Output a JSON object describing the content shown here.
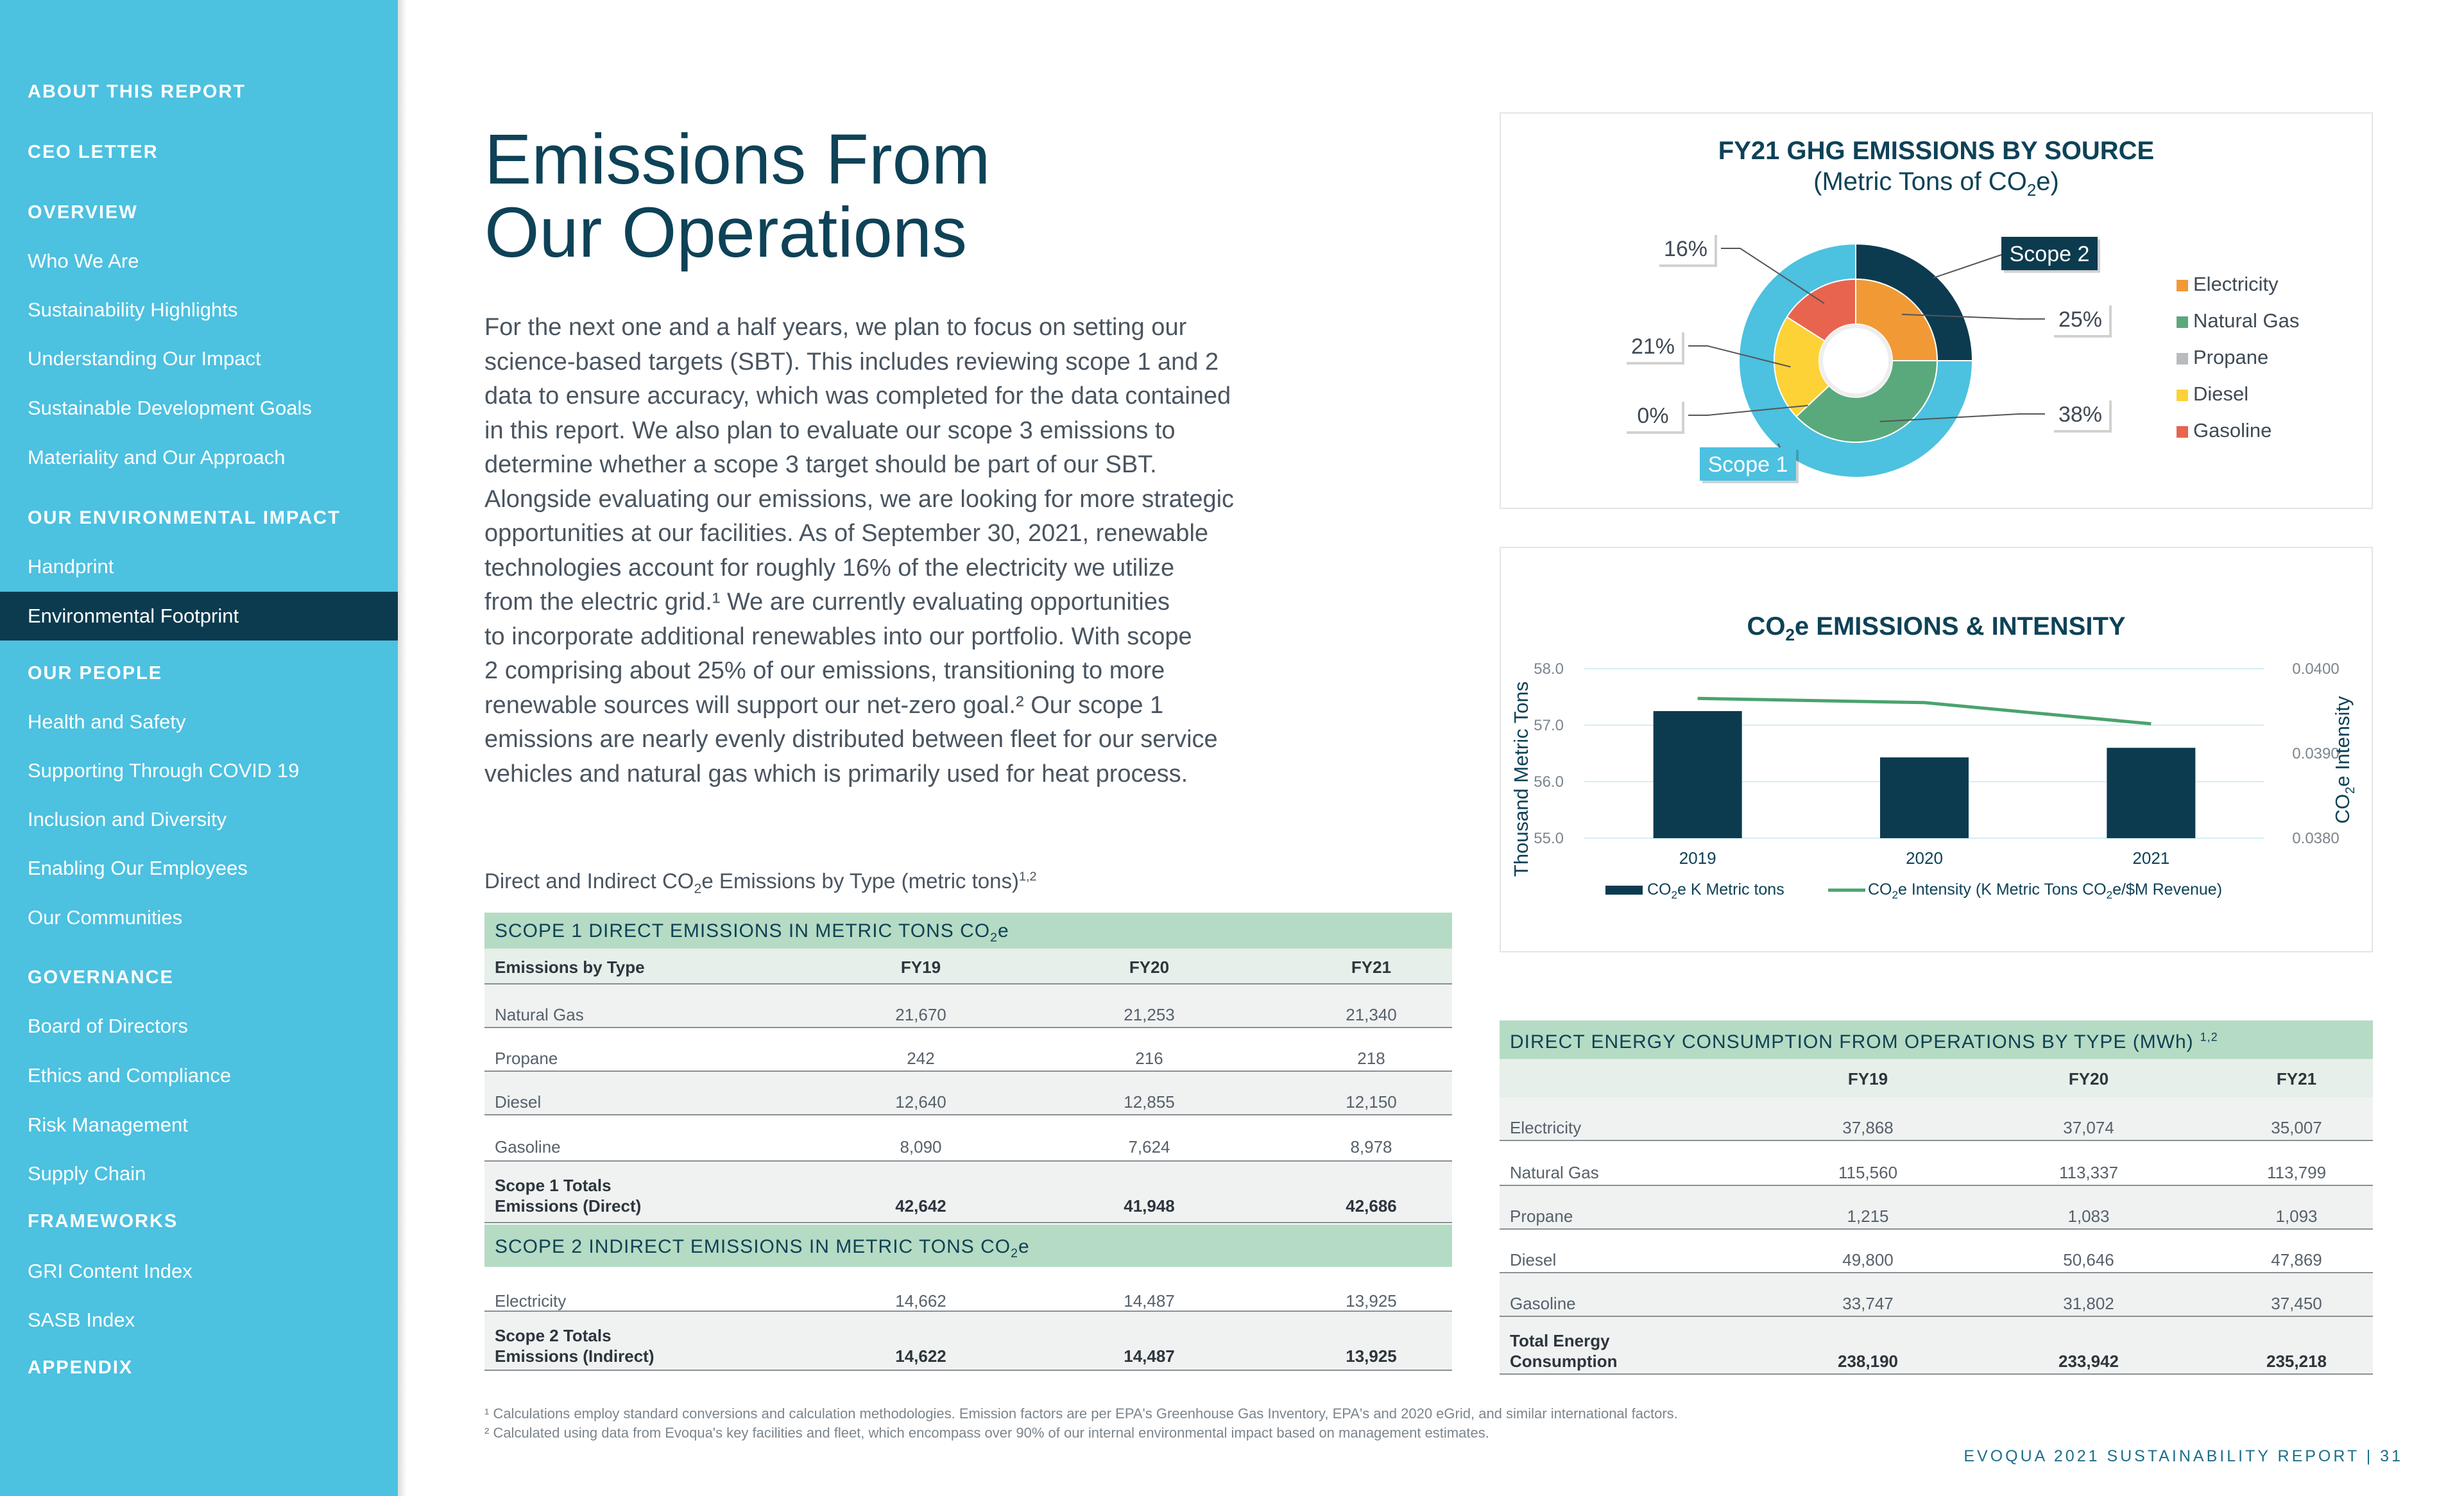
{
  "sidebar": {
    "items": [
      {
        "label": "ABOUT THIS REPORT",
        "type": "head"
      },
      {
        "label": "CEO LETTER",
        "type": "head"
      },
      {
        "label": "OVERVIEW",
        "type": "head"
      },
      {
        "label": "Who We Are",
        "type": "item"
      },
      {
        "label": "Sustainability Highlights",
        "type": "item"
      },
      {
        "label": "Understanding Our Impact",
        "type": "item"
      },
      {
        "label": "Sustainable Development Goals",
        "type": "item"
      },
      {
        "label": "Materiality and Our Approach",
        "type": "item"
      },
      {
        "label": "OUR ENVIRONMENTAL IMPACT",
        "type": "head"
      },
      {
        "label": "Handprint",
        "type": "item"
      },
      {
        "label": "Environmental Footprint",
        "type": "active"
      },
      {
        "label": "OUR PEOPLE",
        "type": "head"
      },
      {
        "label": "Health and Safety",
        "type": "item"
      },
      {
        "label": "Supporting Through COVID 19",
        "type": "item"
      },
      {
        "label": "Inclusion and Diversity",
        "type": "item"
      },
      {
        "label": "Enabling Our Employees",
        "type": "item"
      },
      {
        "label": "Our Communities",
        "type": "item"
      },
      {
        "label": "GOVERNANCE",
        "type": "head"
      },
      {
        "label": "Board of Directors",
        "type": "item"
      },
      {
        "label": "Ethics and Compliance",
        "type": "item"
      },
      {
        "label": "Risk Management",
        "type": "item"
      },
      {
        "label": "Supply Chain",
        "type": "item"
      },
      {
        "label": "FRAMEWORKS",
        "type": "head"
      },
      {
        "label": "GRI Content Index",
        "type": "item"
      },
      {
        "label": "SASB Index",
        "type": "item"
      },
      {
        "label": "APPENDIX",
        "type": "head"
      }
    ]
  },
  "page": {
    "title_line1": "Emissions From",
    "title_line2": "Our Operations",
    "intro": [
      "For the next one and a half years, we plan to focus on setting our",
      "science-based targets (SBT). This includes reviewing scope 1 and 2",
      "data to ensure accuracy, which was completed for the data contained",
      "in this report. We also plan to evaluate our scope 3 emissions to",
      "determine whether a scope 3 target should be part of our SBT.",
      "Alongside evaluating our emissions, we are looking for more strategic",
      "opportunities at our facilities. As of September 30, 2021, renewable",
      "technologies account for roughly 16% of the electricity we utilize",
      "from the electric grid.¹ We are currently evaluating opportunities",
      "to incorporate additional renewables into our portfolio. With scope",
      "2 comprising about 25% of our emissions, transitioning to more",
      "renewable sources will support our net-zero goal.² Our scope 1",
      "emissions are nearly evenly distributed between fleet for our service",
      "vehicles and natural gas which is primarily used for heat process."
    ],
    "table_caption_a": "Direct and Indirect CO",
    "table_caption_b": "e Emissions by Type (metric tons)",
    "table_caption_sup": "1,2"
  },
  "emissions_table": {
    "scope1_band_a": "SCOPE 1 DIRECT EMISSIONS IN METRIC TONS CO",
    "scope1_band_b": "e",
    "headers": [
      "Emissions by Type",
      "FY19",
      "FY20",
      "FY21"
    ],
    "scope1_rows": [
      [
        "Natural Gas",
        "21,670",
        "21,253",
        "21,340"
      ],
      [
        "Propane",
        "242",
        "216",
        "218"
      ],
      [
        "Diesel",
        "12,640",
        "12,855",
        "12,150"
      ],
      [
        "Gasoline",
        "8,090",
        "7,624",
        "8,978"
      ]
    ],
    "scope1_total": {
      "label_1": "Scope 1 Totals",
      "label_2": "Emissions (Direct)",
      "values": [
        "42,642",
        "41,948",
        "42,686"
      ]
    },
    "scope2_band_a": "SCOPE 2 INDIRECT EMISSIONS IN METRIC TONS CO",
    "scope2_band_b": "e",
    "scope2_rows": [
      [
        "Electricity",
        "14,662",
        "14,487",
        "13,925"
      ]
    ],
    "scope2_total": {
      "label_1": "Scope 2 Totals",
      "label_2": "Emissions (Indirect)",
      "values": [
        "14,622",
        "14,487",
        "13,925"
      ]
    }
  },
  "energy_table": {
    "band": "DIRECT ENERGY CONSUMPTION FROM OPERATIONS BY TYPE (MWh)",
    "band_sup": "1,2",
    "headers": [
      "",
      "FY19",
      "FY20",
      "FY21"
    ],
    "rows": [
      [
        "Electricity",
        "37,868",
        "37,074",
        "35,007"
      ],
      [
        "Natural Gas",
        "115,560",
        "113,337",
        "113,799"
      ],
      [
        "Propane",
        "1,215",
        "1,083",
        "1,093"
      ],
      [
        "Diesel",
        "49,800",
        "50,646",
        "47,869"
      ],
      [
        "Gasoline",
        "33,747",
        "31,802",
        "37,450"
      ]
    ],
    "total": {
      "label_1": "Total Energy",
      "label_2": "Consumption",
      "values": [
        "238,190",
        "233,942",
        "235,218"
      ]
    }
  },
  "chart_data": [
    {
      "type": "pie",
      "title": "FY21 GHG EMISSIONS BY SOURCE",
      "subtitle_a": "(Metric Tons of CO",
      "subtitle_b": "e)",
      "rings": [
        {
          "name": "Scope 2",
          "categories": [
            "Electricity"
          ],
          "percent": 25
        },
        {
          "name": "Scope 1",
          "categories": [
            "Natural Gas",
            "Propane",
            "Diesel",
            "Gasoline"
          ],
          "percent": 75
        }
      ],
      "categories": [
        "Electricity",
        "Natural Gas",
        "Propane",
        "Diesel",
        "Gasoline"
      ],
      "values": [
        25,
        38,
        0,
        21,
        16
      ],
      "labels": [
        "25%",
        "38%",
        "0%",
        "21%",
        "16%"
      ],
      "colors": {
        "Electricity": "#f19a35",
        "Natural Gas": "#5aa97c",
        "Propane": "#b9bcbf",
        "Diesel": "#fcd237",
        "Gasoline": "#e8644f",
        "Scope 2": "#0c3b4f",
        "Scope 1": "#4cc1e0"
      },
      "legend_position": "right"
    },
    {
      "type": "bar",
      "title_a": "CO",
      "title_b": "e EMISSIONS & INTENSITY",
      "categories": [
        "2019",
        "2020",
        "2021"
      ],
      "series": [
        {
          "name_a": "CO",
          "name_b": "e K Metric tons",
          "type": "bar",
          "axis": "left",
          "values": [
            57.25,
            56.43,
            56.6
          ],
          "color": "#0c3b4f"
        },
        {
          "name_a": "CO",
          "name_b": "e Intensity (K Metric Tons CO",
          "name_c": "e/$M Revenue)",
          "type": "line",
          "axis": "right",
          "values": [
            0.03965,
            0.0396,
            0.03935
          ],
          "color": "#4aa36d"
        }
      ],
      "ylabel": "Thousand Metric Tons",
      "y2label_a": "CO",
      "y2label_b": "e Intensity",
      "ylim": [
        55.0,
        58.0
      ],
      "yticks": [
        "55.0",
        "56.0",
        "57.0",
        "58.0"
      ],
      "y2lim": [
        0.038,
        0.04
      ],
      "y2ticks": [
        "0.0380",
        "0.0390",
        "0.0400"
      ],
      "grid": true,
      "legend_position": "bottom"
    }
  ],
  "footnotes": [
    "¹ Calculations employ standard conversions and calculation methodologies. Emission factors are per EPA's Greenhouse Gas Inventory, EPA's and 2020 eGrid, and similar international factors.",
    "² Calculated using data from Evoqua's key facilities and fleet, which encompass over 90% of our internal environmental impact based on management estimates."
  ],
  "footer": "EVOQUA 2021 SUSTAINABILITY REPORT | 31"
}
